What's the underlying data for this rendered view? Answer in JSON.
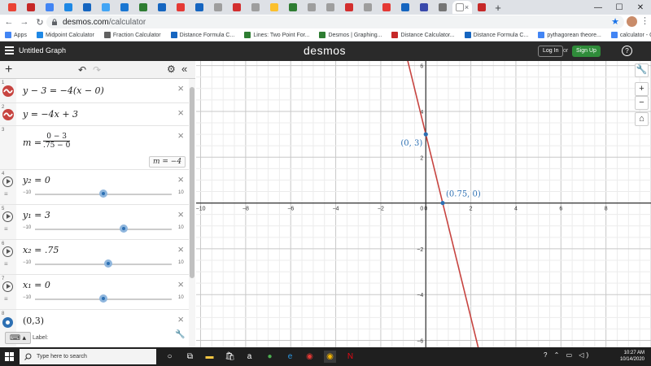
{
  "browser": {
    "tabs": [
      {
        "color": "#ea4335"
      },
      {
        "color": "#c62828"
      },
      {
        "color": "#4285f4"
      },
      {
        "color": "#1e88e5"
      },
      {
        "color": "#1565c0"
      },
      {
        "color": "#42a5f5"
      },
      {
        "color": "#1976d2"
      },
      {
        "color": "#2e7d32"
      },
      {
        "color": "#1565c0"
      },
      {
        "color": "#e53935"
      },
      {
        "color": "#1565c0"
      },
      {
        "color": "#9e9e9e"
      },
      {
        "color": "#d32f2f"
      },
      {
        "color": "#9e9e9e"
      },
      {
        "color": "#fbc02d"
      },
      {
        "color": "#2e7d32"
      },
      {
        "color": "#9e9e9e"
      },
      {
        "color": "#9e9e9e"
      },
      {
        "color": "#d32f2f"
      },
      {
        "color": "#9e9e9e"
      },
      {
        "color": "#e53935"
      },
      {
        "color": "#1565c0"
      },
      {
        "color": "#3949ab"
      },
      {
        "color": "#757575"
      },
      {
        "color": "#ffffff"
      },
      {
        "color": "#c62828"
      }
    ],
    "new_tab_label": "+",
    "window_controls": {
      "minimize": "—",
      "maximize": "☐",
      "close": "✕"
    },
    "url_host": "desmos.com",
    "url_path": "/calculator",
    "bookmarks": [
      {
        "label": "Apps",
        "color": "#4285f4"
      },
      {
        "label": "Midpoint Calculator",
        "color": "#1e88e5"
      },
      {
        "label": "Fraction Calculator",
        "color": "#616161"
      },
      {
        "label": "Distance Formula C...",
        "color": "#1565c0"
      },
      {
        "label": "Lines: Two Point For...",
        "color": "#2e7d32"
      },
      {
        "label": "Desmos | Graphing...",
        "color": "#2e7d32"
      },
      {
        "label": "Distance Calculator...",
        "color": "#c62828"
      },
      {
        "label": "Distance Formula C...",
        "color": "#1565c0"
      },
      {
        "label": "pythagorean theore...",
        "color": "#4285f4"
      },
      {
        "label": "calculator - Google...",
        "color": "#4285f4"
      }
    ]
  },
  "desmos": {
    "graph_title": "Untitled Graph",
    "brand": "desmos",
    "login": "Log In",
    "or": "or",
    "signup": "Sign Up",
    "help": "?"
  },
  "expressions": {
    "add": "+",
    "undo": "↶",
    "redo": "↷",
    "settings": "⚙",
    "collapse": "«",
    "items": [
      {
        "n": "1",
        "text": "y − 3 = −4(x − 0)"
      },
      {
        "n": "2",
        "text": "y = −4x + 3"
      },
      {
        "n": "3",
        "m_label": "m =",
        "numerator": "0 − 3",
        "denominator": ".75 − 0",
        "result": "m = −4"
      },
      {
        "n": "4",
        "text": "y₂ = 0",
        "min": "−10",
        "max": "10",
        "value": 0
      },
      {
        "n": "5",
        "text": "y₁ = 3",
        "min": "−10",
        "max": "10",
        "value": 3
      },
      {
        "n": "6",
        "text": "x₂ = .75",
        "min": "−10",
        "max": "10",
        "value": 0.75
      },
      {
        "n": "7",
        "text": "x₁ = 0",
        "min": "−10",
        "max": "10",
        "value": 0
      },
      {
        "n": "8",
        "text": "(0,3)",
        "label": "Label:"
      }
    ],
    "keyboard": "⌨ ▴"
  },
  "chart_data": {
    "type": "line",
    "xlim": [
      -10.2,
      10.0
    ],
    "ylim": [
      -6.3,
      6.2
    ],
    "grid": true,
    "x_ticks": [
      -10,
      -8,
      -6,
      -4,
      -2,
      0,
      2,
      4,
      6,
      8
    ],
    "y_ticks": [
      -6,
      -4,
      -2,
      2,
      4,
      6
    ],
    "series": [
      {
        "equation": "y = −4x + 3",
        "slope": -4,
        "intercept": 3,
        "color": "#c74440"
      }
    ],
    "points": [
      {
        "x": 0,
        "y": 3,
        "label": "(0, 3)",
        "color": "#2d70b3"
      },
      {
        "x": 0.75,
        "y": 0,
        "label": "(0.75, 0)",
        "color": "#2d70b3"
      }
    ]
  },
  "graph_tools": [
    "🔧",
    "+",
    "−",
    "⌂"
  ],
  "taskbar": {
    "search_placeholder": "Type here to search",
    "time": "10:27 AM",
    "date": "10/14/2020",
    "tray_icons": "? ⌃ ▭ ◁)"
  }
}
